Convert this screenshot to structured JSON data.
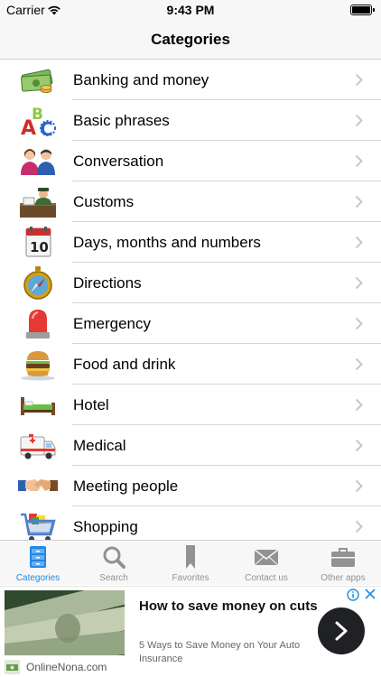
{
  "status_bar": {
    "carrier": "Carrier",
    "time": "9:43 PM",
    "wifi_icon": "wifi-icon",
    "battery_icon": "battery-icon"
  },
  "nav": {
    "title": "Categories"
  },
  "categories": [
    {
      "label": "Banking and money",
      "icon": "money-icon"
    },
    {
      "label": "Basic phrases",
      "icon": "abc-blocks-icon"
    },
    {
      "label": "Conversation",
      "icon": "people-talking-icon"
    },
    {
      "label": "Customs",
      "icon": "customs-officer-icon"
    },
    {
      "label": "Days, months and numbers",
      "icon": "calendar-icon"
    },
    {
      "label": "Directions",
      "icon": "compass-icon"
    },
    {
      "label": "Emergency",
      "icon": "siren-icon"
    },
    {
      "label": "Food and drink",
      "icon": "burger-icon"
    },
    {
      "label": "Hotel",
      "icon": "bed-icon"
    },
    {
      "label": "Medical",
      "icon": "ambulance-icon"
    },
    {
      "label": "Meeting people",
      "icon": "handshake-icon"
    },
    {
      "label": "Shopping",
      "icon": "shopping-cart-icon"
    }
  ],
  "tabs": [
    {
      "label": "Categories",
      "icon": "filing-cabinet-icon",
      "active": true
    },
    {
      "label": "Search",
      "icon": "magnifier-icon",
      "active": false
    },
    {
      "label": "Favorites",
      "icon": "bookmark-icon",
      "active": false
    },
    {
      "label": "Contact us",
      "icon": "envelope-icon",
      "active": false
    },
    {
      "label": "Other apps",
      "icon": "briefcase-icon",
      "active": false
    }
  ],
  "ad": {
    "title": "How to save money on cuts",
    "description": "5 Ways to Save Money on Your Auto Insurance",
    "source": "OnlineNona.com",
    "image_icon": "dollar-bills-icon",
    "cta_icon": "chevron-right-icon",
    "info_icon": "ad-info-icon",
    "close_icon": "close-icon"
  },
  "colors": {
    "accent": "#1f86e8",
    "tab_inactive": "#929292",
    "bar_background": "#f7f7f7",
    "separator": "#d6d6da",
    "chevron": "#c7c7cc"
  }
}
